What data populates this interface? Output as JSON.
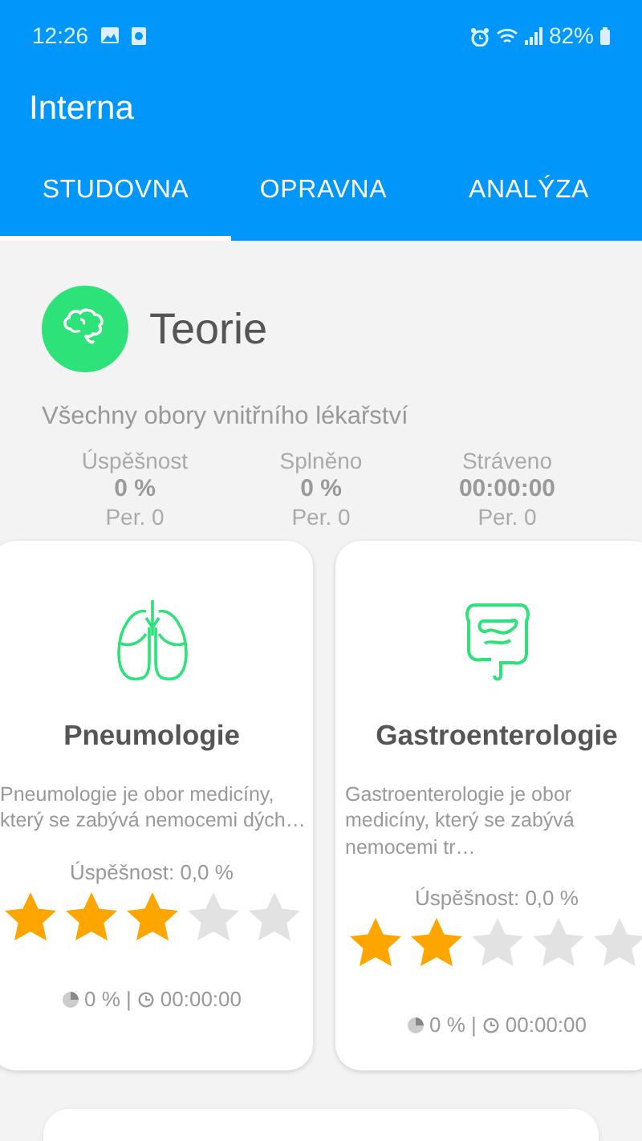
{
  "status_bar": {
    "time": "12:26",
    "battery": "82%"
  },
  "app_bar": {
    "title": "Interna"
  },
  "tabs": [
    {
      "label": "STUDOVNA",
      "selected": true
    },
    {
      "label": "OPRAVNA",
      "selected": false
    },
    {
      "label": "ANALÝZA",
      "selected": false
    }
  ],
  "header": {
    "title": "Teorie",
    "subtitle": "Všechny obory vnitřního lékařství",
    "stats": [
      {
        "label": "Úspěšnost",
        "value": "0 %",
        "period": "Per. 0"
      },
      {
        "label": "Splněno",
        "value": "0 %",
        "period": "Per. 0"
      },
      {
        "label": "Stráveno",
        "value": "00:00:00",
        "period": "Per. 0"
      }
    ]
  },
  "cards": [
    {
      "kind": "lungs",
      "title": "Pneumologie",
      "description": "Pneumologie je obor medicíny, který se zabývá nemocemi dých…",
      "success": "Úspěšnost: 0,0 %",
      "stars": 3,
      "progress": "0 % |",
      "time": "00:00:00"
    },
    {
      "kind": "intestines",
      "title": "Gastroenterologie",
      "description": "Gastroenterologie je obor medicíny, který se zabývá nemocemi tr…",
      "success": "Úspěšnost: 0,0 %",
      "stars": 2,
      "progress": "0 % |",
      "time": "00:00:00"
    }
  ]
}
